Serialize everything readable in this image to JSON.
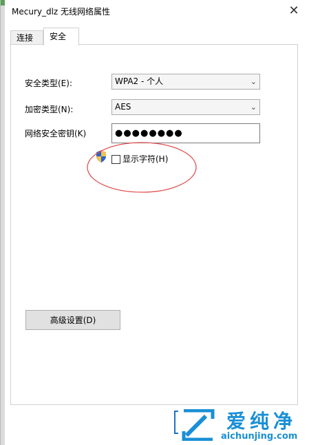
{
  "window": {
    "title": "Mecury_dlz 无线网络属性",
    "close_glyph": "✕"
  },
  "tabs": [
    {
      "label": "连接",
      "active": false
    },
    {
      "label": "安全",
      "active": true
    }
  ],
  "security": {
    "type_label": "安全类型(E):",
    "type_value": "WPA2 - 个人",
    "encryption_label": "加密类型(N):",
    "encryption_value": "AES",
    "key_label": "网络安全密钥(K)",
    "key_value": "●●●●●●●●",
    "show_chars_label": "显示字符(H)",
    "show_chars_checked": false
  },
  "advanced_button": "高级设置(D)",
  "watermark": {
    "cn": "爱纯净",
    "en": "aichunjing.com"
  },
  "colors": {
    "annotation_ellipse": "#e05050",
    "watermark_blue": "#1a8fd6"
  }
}
